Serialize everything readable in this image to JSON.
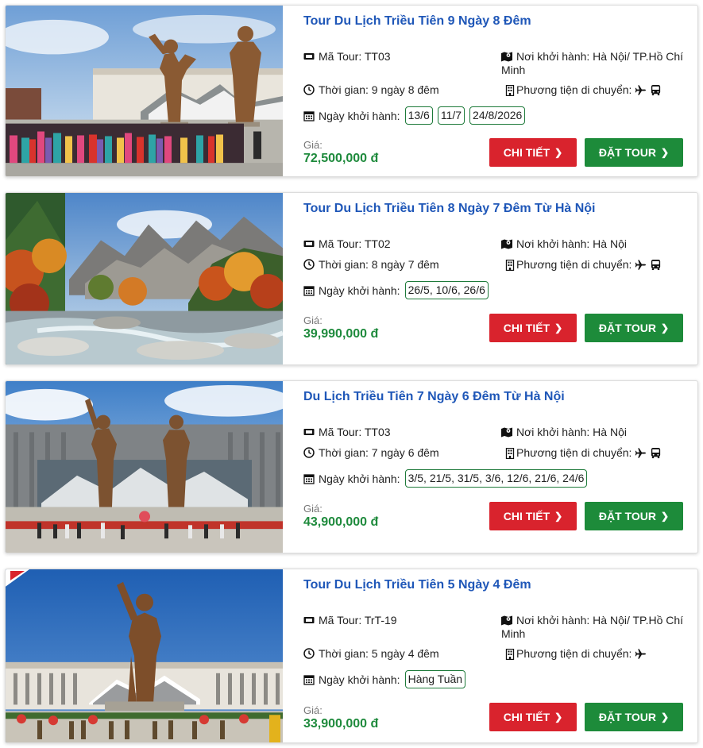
{
  "labels": {
    "code": "Mã Tour:",
    "origin": "Nơi khởi hành:",
    "duration": "Thời gian:",
    "transport": "Phương tiện di chuyển:",
    "dates": "Ngày khởi hành:",
    "price": "Giá:",
    "detail_button": "CHI TIẾT",
    "book_button": "ĐẶT TOUR"
  },
  "colors": {
    "title": "#1f57b8",
    "price": "#1e8a3c",
    "detail": "#d9232d",
    "book": "#1d8b3a"
  },
  "tours": [
    {
      "title": "Tour Du Lịch Triều Tiên 9 Ngày 8 Đêm",
      "code": "Mã Tour: TT03",
      "origin": "Nơi khởi hành: Hà Nội/ TP.Hồ Chí Minh",
      "duration": "Thời gian: 9 ngày 8 đêm",
      "transport_icons": [
        "plane-icon",
        "bus-icon"
      ],
      "dates": [
        "13/6",
        "11/7",
        "24/8/2026"
      ],
      "price": "72,500,000 đ",
      "image": "statues-with-crowd"
    },
    {
      "title": "Tour Du Lịch Triều Tiên 8 Ngày 7 Đêm Từ Hà Nội",
      "code": "Mã Tour: TT02",
      "origin": "Nơi khởi hành: Hà Nội",
      "duration": "Thời gian: 8 ngày 7 đêm",
      "transport_icons": [
        "plane-icon",
        "bus-icon"
      ],
      "dates": [
        "26/5, 10/6, 26/6"
      ],
      "price": "39,990,000 đ",
      "image": "autumn-mountain-stream"
    },
    {
      "title": "Du Lịch Triều Tiên 7 Ngày 6 Đêm Từ Hà Nội",
      "code": "Mã Tour: TT03",
      "origin": "Nơi khởi hành: Hà Nội",
      "duration": "Thời gian: 7 ngày 6 đêm",
      "transport_icons": [
        "plane-icon",
        "bus-icon"
      ],
      "dates": [
        "3/5, 21/5, 31/5, 3/6, 12/6, 21/6, 24/6"
      ],
      "price": "43,900,000 đ",
      "image": "two-statues-plaza"
    },
    {
      "title": "Tour Du Lịch Triều Tiên 5 Ngày 4 Đêm",
      "code": "Mã Tour: TrT-19",
      "origin": "Nơi khởi hành: Hà Nội/ TP.Hồ Chí Minh",
      "duration": "Thời gian: 5 ngày 4 đêm",
      "transport_icons": [
        "plane-icon"
      ],
      "dates": [
        "Hàng Tuần"
      ],
      "price": "33,900,000 đ",
      "image": "single-statue-blue-sky"
    }
  ]
}
